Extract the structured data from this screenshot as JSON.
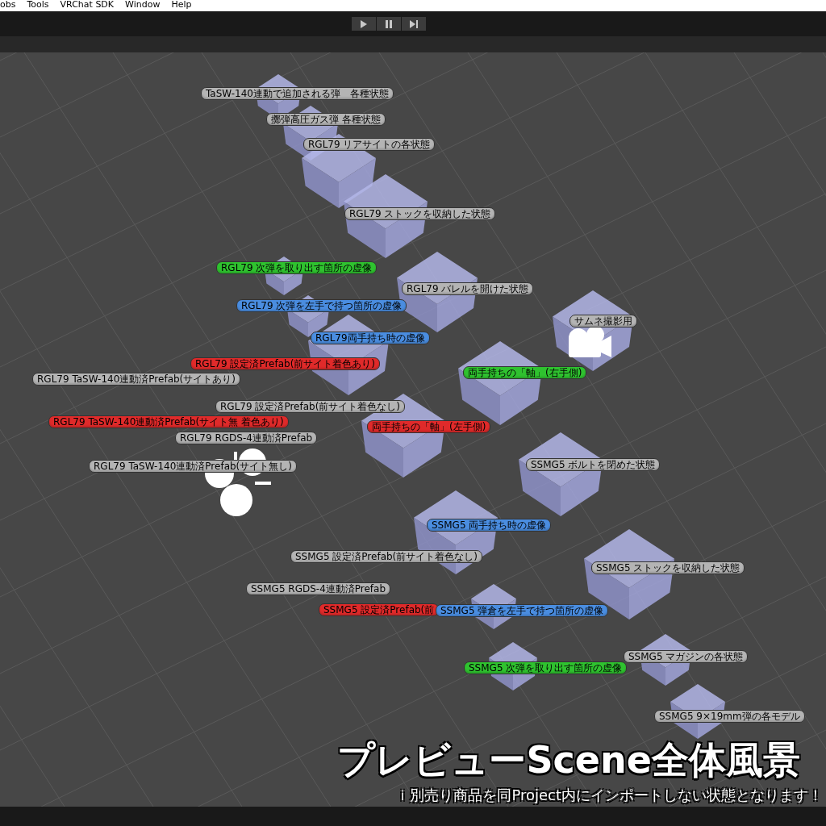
{
  "menu_bar": {
    "items": [
      "obs",
      "Tools",
      "VRChat SDK",
      "Window",
      "Help"
    ]
  },
  "scene": {
    "labels": [
      {
        "text": "TaSW-140連動で追加される弾　各種状態",
        "color": "#b4b4b4"
      },
      {
        "text": "擲弾高圧ガス弾 各種状態",
        "color": "#b4b4b4"
      },
      {
        "text": "RGL79 リアサイトの各状態",
        "color": "#b4b4b4"
      },
      {
        "text": "RGL79 ストックを収納した状態",
        "color": "#b4b4b4"
      },
      {
        "text": "RGL79 次弾を取り出す箇所の虚像",
        "color": "#2fc22f"
      },
      {
        "text": "RGL79 バレルを開けた状態",
        "color": "#b4b4b4"
      },
      {
        "text": "RGL79 次弾を左手で持つ箇所の虚像",
        "color": "#4a8de0"
      },
      {
        "text": "サムネ撮影用",
        "color": "#b4b4b4"
      },
      {
        "text": "RGL79両手持ち時の虚像",
        "color": "#4a8de0"
      },
      {
        "text": "RGL79 設定済Prefab(前サイト着色あり)",
        "color": "#e02a2a"
      },
      {
        "text": "RGL79 TaSW-140連動済Prefab(サイトあり)",
        "color": "#b4b4b4"
      },
      {
        "text": "両手持ちの「軸」(右手側)",
        "color": "#2fc22f"
      },
      {
        "text": "RGL79 設定済Prefab(前サイト着色なし)",
        "color": "#b4b4b4"
      },
      {
        "text": "RGL79 TaSW-140連動済Prefab(サイト無 着色あり)",
        "color": "#e02a2a"
      },
      {
        "text": "両手持ちの「軸」(左手側)",
        "color": "#e02a2a"
      },
      {
        "text": "RGL79 RGDS-4連動済Prefab",
        "color": "#b4b4b4"
      },
      {
        "text": "RGL79 TaSW-140連動済Prefab(サイト無し)",
        "color": "#b4b4b4"
      },
      {
        "text": "SSMG5 ボルトを閉めた状態",
        "color": "#b4b4b4"
      },
      {
        "text": "SSMG5 両手持ち時の虚像",
        "color": "#4a8de0"
      },
      {
        "text": "SSMG5 設定済Prefab(前サイト着色なし)",
        "color": "#b4b4b4"
      },
      {
        "text": "SSMG5 ストックを収納した状態",
        "color": "#b4b4b4"
      },
      {
        "text": "SSMG5 RGDS-4連動済Prefab",
        "color": "#b4b4b4"
      },
      {
        "text": "SSMG5 設定済Prefab(前",
        "color": "#e02a2a"
      },
      {
        "text": "SSMG5 弾倉を左手で持つ箇所の虚像",
        "color": "#4a8de0"
      },
      {
        "text": "SSMG5 マガジンの各状態",
        "color": "#b4b4b4"
      },
      {
        "text": "SSMG5 次弾を取り出す箇所の虚像",
        "color": "#2fc22f"
      },
      {
        "text": "SSMG5 9×19mm弾の各モデル",
        "color": "#b4b4b4"
      }
    ]
  },
  "caption": {
    "title": "プレビューScene全体風景",
    "subtitle": "ｉ別売り商品を同Project内にインポートしない状態となります！"
  }
}
